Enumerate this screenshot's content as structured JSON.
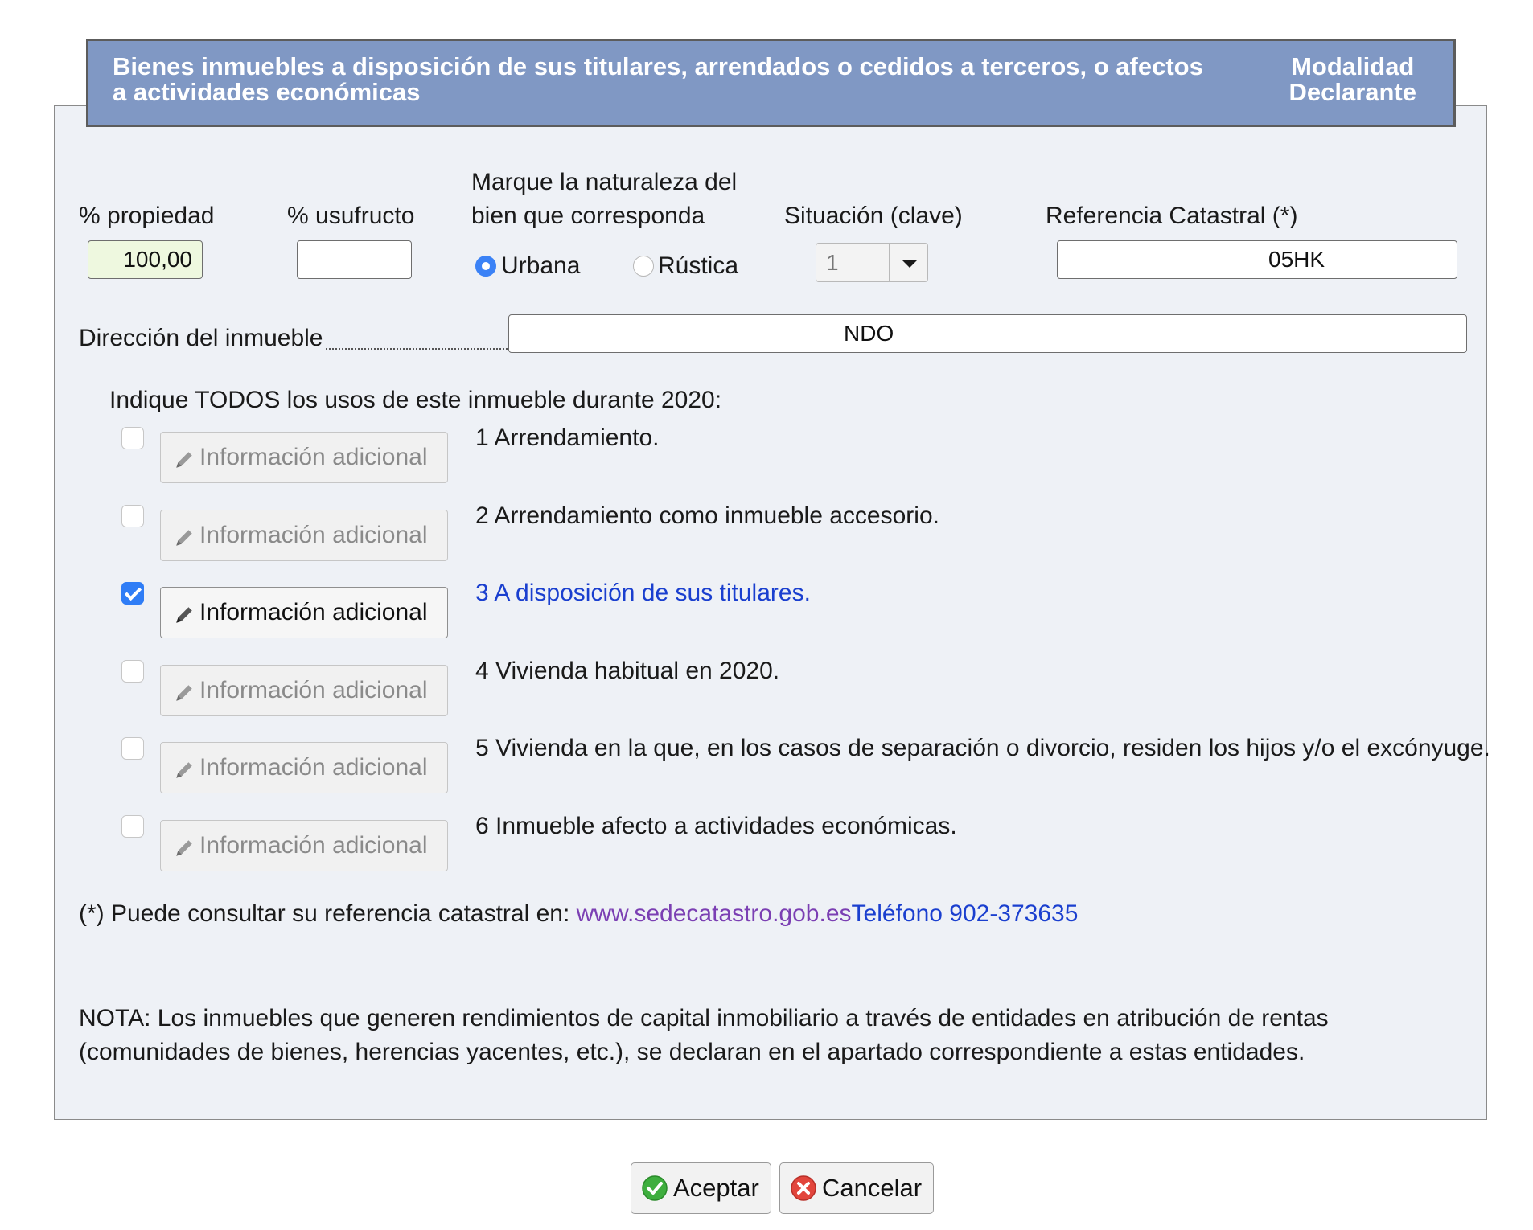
{
  "header": {
    "title": "Bienes inmuebles a disposición de sus titulares, arrendados o cedidos a terceros, o afectos a actividades económicas",
    "right_line1": "Modalidad",
    "right_line2": "Declarante"
  },
  "form": {
    "propiedad_label": "% propiedad",
    "propiedad_value": "100,00",
    "usufructo_label": "% usufructo",
    "usufructo_value": "",
    "naturaleza_label_line1": "Marque la naturaleza del",
    "naturaleza_label_line2": "bien que corresponda",
    "urbana_label": "Urbana",
    "urbana_selected": true,
    "rustica_label": "Rústica",
    "rustica_selected": false,
    "situacion_label": "Situación (clave)",
    "situacion_value": "1",
    "referencia_label": "Referencia Catastral (*)",
    "referencia_value": "05HK",
    "direccion_label": "Dirección del inmueble",
    "direccion_value": "NDO"
  },
  "usos": {
    "heading": "Indique TODOS los usos de este inmueble durante 2020:",
    "button_label": "Información adicional",
    "items": [
      {
        "text": "1 Arrendamiento.",
        "checked": false
      },
      {
        "text": "2 Arrendamiento como inmueble accesorio.",
        "checked": false
      },
      {
        "text": "3 A disposición de sus titulares.",
        "checked": true
      },
      {
        "text": "4 Vivienda habitual en 2020.",
        "checked": false
      },
      {
        "text": "5 Vivienda en la que, en los casos de separación o divorcio, residen los hijos y/o el excónyuge.",
        "checked": false
      },
      {
        "text": "6 Inmueble afecto a actividades económicas.",
        "checked": false
      }
    ]
  },
  "footer_note": {
    "prefix": "(*) Puede consultar su referencia catastral en: ",
    "link_web": "www.sedecatastro.gob.es",
    "link_phone": "Teléfono 902-373635",
    "nota_line1": "NOTA: Los inmuebles que generen rendimientos de capital inmobiliario a través de entidades en atribución de rentas",
    "nota_line2": "(comunidades de bienes, herencias yacentes, etc.), se declaran en el apartado correspondiente a estas entidades."
  },
  "actions": {
    "accept_label": "Aceptar",
    "cancel_label": "Cancelar"
  },
  "colors": {
    "header_bg": "#8098c4",
    "active_link": "#1a3fcf",
    "visited_link": "#7b3fb3",
    "highlight_input": "#eef8df",
    "check_blue": "#2f7df6"
  }
}
